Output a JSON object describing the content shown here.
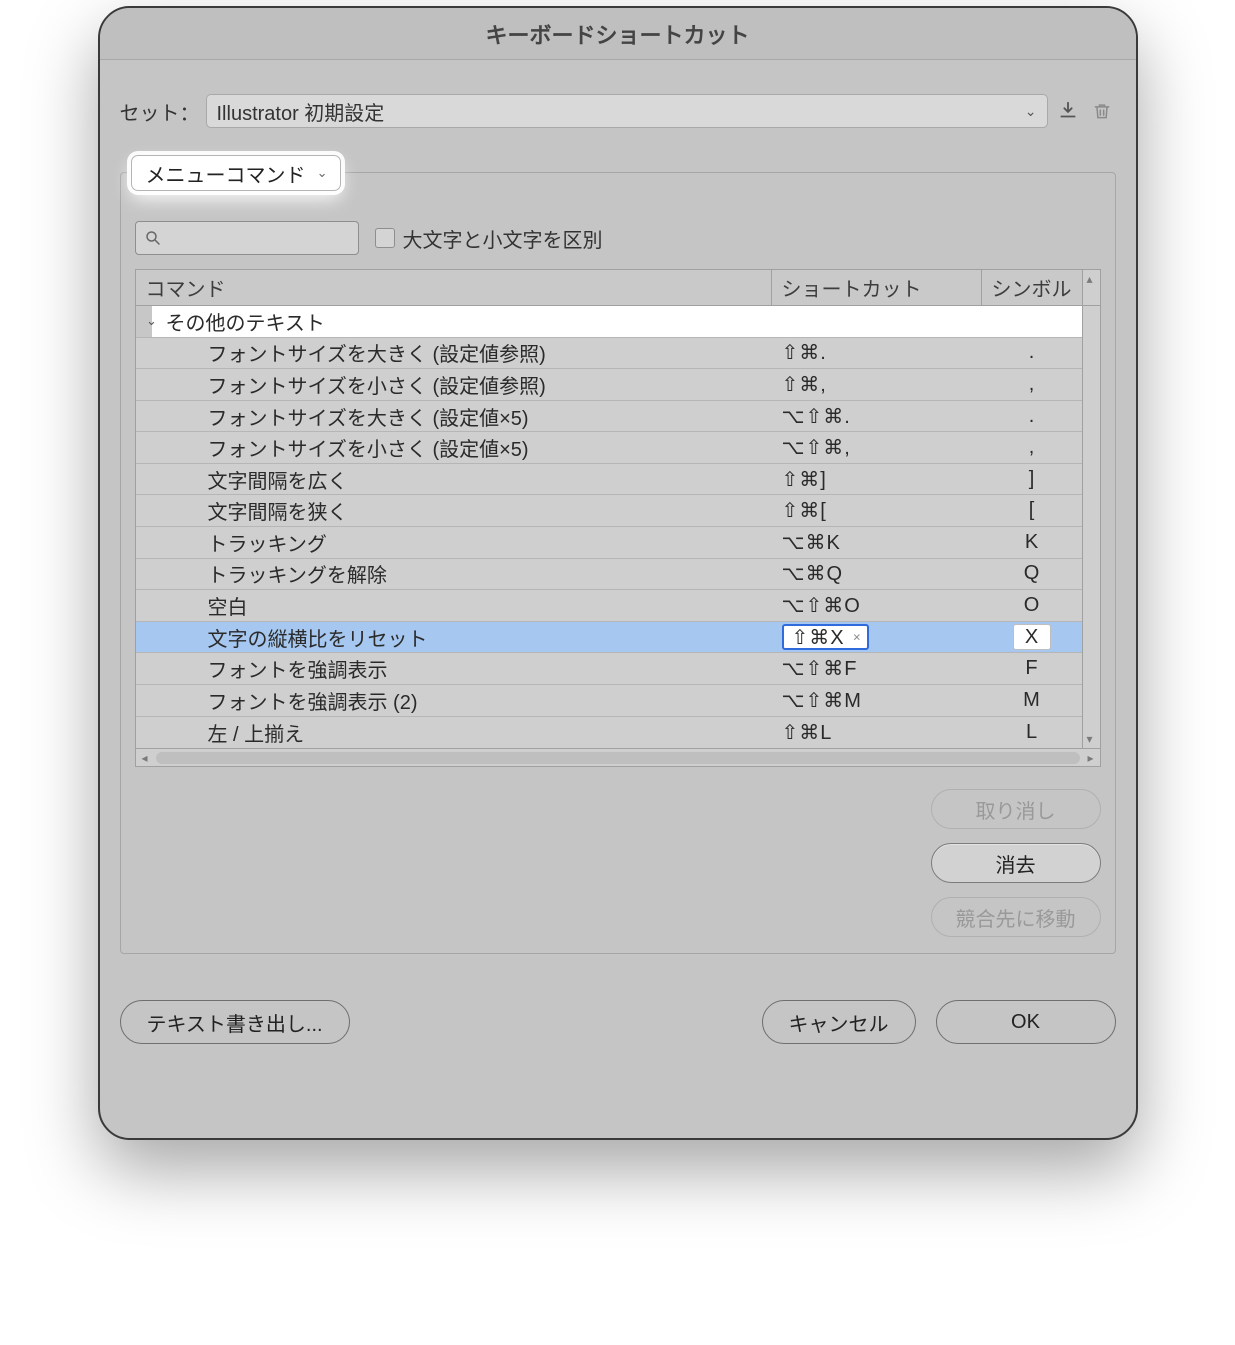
{
  "dialog": {
    "title": "キーボードショートカット",
    "set_label": "セット：",
    "set_value": "Illustrator 初期設定",
    "category_value": "メニューコマンド",
    "case_sensitive_label": "大文字と小文字を区別",
    "search_placeholder": ""
  },
  "columns": {
    "command": "コマンド",
    "shortcut": "ショートカット",
    "symbol": "シンボル"
  },
  "group": {
    "name": "その他のテキスト"
  },
  "rows": [
    {
      "command": "フォントサイズを大きく (設定値参照)",
      "shortcut": "⇧⌘.",
      "symbol": "."
    },
    {
      "command": "フォントサイズを小さく (設定値参照)",
      "shortcut": "⇧⌘,",
      "symbol": ","
    },
    {
      "command": "フォントサイズを大きく (設定値×5)",
      "shortcut": "⌥⇧⌘.",
      "symbol": "."
    },
    {
      "command": "フォントサイズを小さく (設定値×5)",
      "shortcut": "⌥⇧⌘,",
      "symbol": ","
    },
    {
      "command": "文字間隔を広く",
      "shortcut": "⇧⌘]",
      "symbol": "]"
    },
    {
      "command": "文字間隔を狭く",
      "shortcut": "⇧⌘[",
      "symbol": "["
    },
    {
      "command": "トラッキング",
      "shortcut": "⌥⌘K",
      "symbol": "K"
    },
    {
      "command": "トラッキングを解除",
      "shortcut": "⌥⌘Q",
      "symbol": "Q"
    },
    {
      "command": "空白",
      "shortcut": "⌥⇧⌘O",
      "symbol": "O"
    },
    {
      "command": "文字の縦横比をリセット",
      "shortcut": "⇧⌘X",
      "symbol": "X",
      "selected": true
    },
    {
      "command": "フォントを強調表示",
      "shortcut": "⌥⇧⌘F",
      "symbol": "F"
    },
    {
      "command": "フォントを強調表示 (2)",
      "shortcut": "⌥⇧⌘M",
      "symbol": "M"
    },
    {
      "command": "左 / 上揃え",
      "shortcut": "⇧⌘L",
      "symbol": "L"
    }
  ],
  "buttons": {
    "undo": "取り消し",
    "clear": "消去",
    "goto_conflict": "競合先に移動",
    "export": "テキスト書き出し...",
    "cancel": "キャンセル",
    "ok": "OK"
  }
}
